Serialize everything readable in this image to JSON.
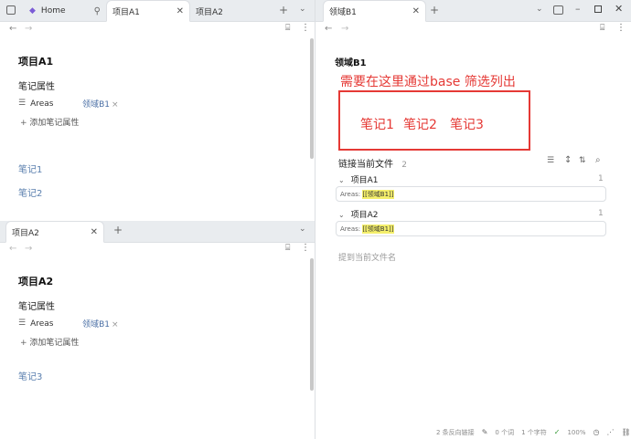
{
  "left_top": {
    "tabs": [
      {
        "label": "Home"
      },
      {
        "label": "项目A1"
      },
      {
        "label": "项目A2"
      }
    ],
    "title": "项目A1",
    "properties_header": "笔记属性",
    "property": {
      "key": "Areas",
      "value": "领域B1"
    },
    "add_property": "添加笔记属性",
    "links": [
      "笔记1",
      "笔记2"
    ]
  },
  "left_bottom": {
    "tab": "项目A2",
    "title": "项目A2",
    "properties_header": "笔记属性",
    "property": {
      "key": "Areas",
      "value": "领域B1"
    },
    "add_property": "添加笔记属性",
    "links": [
      "笔记3"
    ]
  },
  "right": {
    "tab": "领域B1",
    "title": "领域B1",
    "annotation": "需要在这里通过base 筛选列出",
    "boxed_notes": [
      "笔记1",
      "笔记2",
      "笔记3"
    ],
    "backlinks": {
      "header": "链接当前文件",
      "count": "2",
      "groups": [
        {
          "name": "项目A1",
          "count": "1",
          "excerpt_prefix": "Areas: ",
          "excerpt_link": "[[领域B1]]"
        },
        {
          "name": "项目A2",
          "count": "1",
          "excerpt_prefix": "Areas: ",
          "excerpt_link": "[[领域B1]]"
        }
      ]
    },
    "unlinked_mentions": "提到当前文件名"
  },
  "status_bar": {
    "backlinks": "2 条反向链接",
    "words": "0 个词",
    "chars": "1 个字符",
    "zoom": "100%"
  },
  "colors": {
    "annotation_red": "#e53935",
    "highlight": "#f4ef6b",
    "link_blue": "#5a7fae"
  }
}
